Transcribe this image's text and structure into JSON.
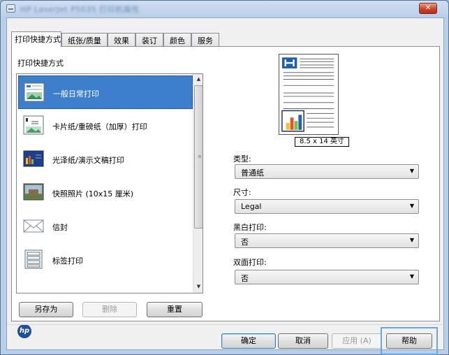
{
  "window": {
    "title": "HP LaserJet P5035 打印机属性",
    "close_label": "✕"
  },
  "tabs": [
    {
      "label": "打印快捷方式",
      "active": true
    },
    {
      "label": "纸张/质量",
      "active": false
    },
    {
      "label": "效果",
      "active": false
    },
    {
      "label": "装订",
      "active": false
    },
    {
      "label": "颜色",
      "active": false
    },
    {
      "label": "服务",
      "active": false
    }
  ],
  "shortcuts": {
    "heading": "打印快捷方式",
    "items": [
      {
        "label": "一般日常打印",
        "icon": "general-print-icon",
        "selected": true
      },
      {
        "label": "卡片纸/重磅纸（加厚）打印",
        "icon": "cardstock-icon",
        "selected": false
      },
      {
        "label": "光泽纸/演示文稿打印",
        "icon": "presentation-icon",
        "selected": false
      },
      {
        "label": "快照照片 (10x15 厘米)",
        "icon": "photo-icon",
        "selected": false
      },
      {
        "label": "信封",
        "icon": "envelope-icon",
        "selected": false
      },
      {
        "label": "标签打印",
        "icon": "labels-icon",
        "selected": false
      }
    ],
    "buttons": {
      "save_as": "另存为",
      "delete": "删除",
      "reset": "重置"
    }
  },
  "preview": {
    "size_label": "8.5 x 14 英寸"
  },
  "settings": {
    "type": {
      "label": "类型:",
      "value": "普通纸"
    },
    "size": {
      "label": "尺寸:",
      "value": "Legal"
    },
    "bw": {
      "label": "黑白打印:",
      "value": "否"
    },
    "duplex": {
      "label": "双面打印:",
      "value": "否"
    }
  },
  "footer": {
    "ok": "确定",
    "cancel": "取消",
    "apply": "应用 (A)",
    "help": "帮助"
  },
  "brand": {
    "logo_text": "hp",
    "color": "#1f4f96"
  }
}
